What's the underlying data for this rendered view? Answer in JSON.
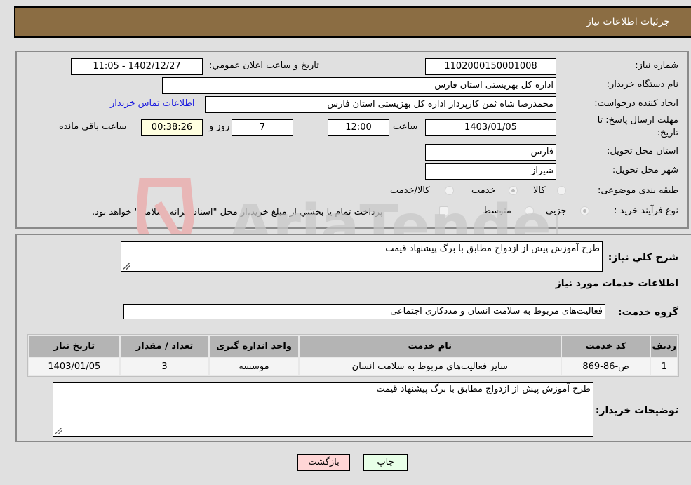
{
  "header": {
    "title": "جزئیات اطلاعات نیاز"
  },
  "details": {
    "need_number_label": "شماره نیاز:",
    "need_number": "1102000150001008",
    "announce_label": "تاریخ و ساعت اعلان عمومي:",
    "announce_value": "1402/12/27 - 11:05",
    "buyer_org_label": "نام دستگاه خريدار:",
    "buyer_org": "اداره کل بهزیستی استان فارس",
    "creator_label": "ایجاد کننده درخواست:",
    "creator": "محمدرضا شاه ثمن کارپرداز اداره کل بهزیستی استان فارس",
    "buyer_contact_link": "اطلاعات تماس خریدار",
    "deadline_label_line1": "مهلت ارسال پاسخ: تا",
    "deadline_label_line2": "تاريخ:",
    "deadline_date": "1403/01/05",
    "time_label": "ساعت",
    "deadline_time": "12:00",
    "days_value": "7",
    "days_label": "روز و",
    "remaining_time": "00:38:26",
    "remaining_label": "ساعت باقي مانده",
    "province_label": "استان محل تحویل:",
    "province": "فارس",
    "city_label": "شهر محل تحویل:",
    "city": "شیراز",
    "category_label": "طبقه بندی موضوعی:",
    "category_options": [
      {
        "label": "کالا",
        "checked": false
      },
      {
        "label": "خدمت",
        "checked": true
      },
      {
        "label": "کالا/خدمت",
        "checked": false
      }
    ],
    "purchase_type_label": "نوع فرآيند خريد :",
    "purchase_type_options": [
      {
        "label": "جزيي",
        "checked": true
      },
      {
        "label": "متوسط",
        "checked": false
      }
    ],
    "treasury_note": "پرداخت تمام يا بخشي از مبلغ خريد،از محل \"اسناد خزانه اسلامي\" خواهد بود.",
    "treasury_checked": false
  },
  "summary": {
    "general_desc_label": "شرح کلي نياز:",
    "general_desc": "طرح آموزش پیش از ازدواج مطابق با برگ پیشنهاد قیمت",
    "services_heading": "اطلاعات خدمات مورد نیاز",
    "service_group_label": "گروه خدمت:",
    "service_group": "فعالیت‌های مربوط به سلامت انسان و مددکاری اجتماعی",
    "table": {
      "headers": [
        "ردیف",
        "کد خدمت",
        "نام خدمت",
        "واحد اندازه گیری",
        "تعداد / مقدار",
        "تاریخ نیاز"
      ],
      "rows": [
        [
          "1",
          "ص-86-869",
          "سایر فعالیت‌های مربوط به سلامت انسان",
          "موسسه",
          "3",
          "1403/01/05"
        ]
      ]
    },
    "buyer_notes_label": "توضیحات خریدار:",
    "buyer_notes": "طرح آموزش پیش از ازدواج مطابق با برگ پیشنهاد قیمت"
  },
  "buttons": {
    "print": "چاپ",
    "back": "بازگشت"
  },
  "watermark": {
    "text": "AriaTender.neT"
  }
}
